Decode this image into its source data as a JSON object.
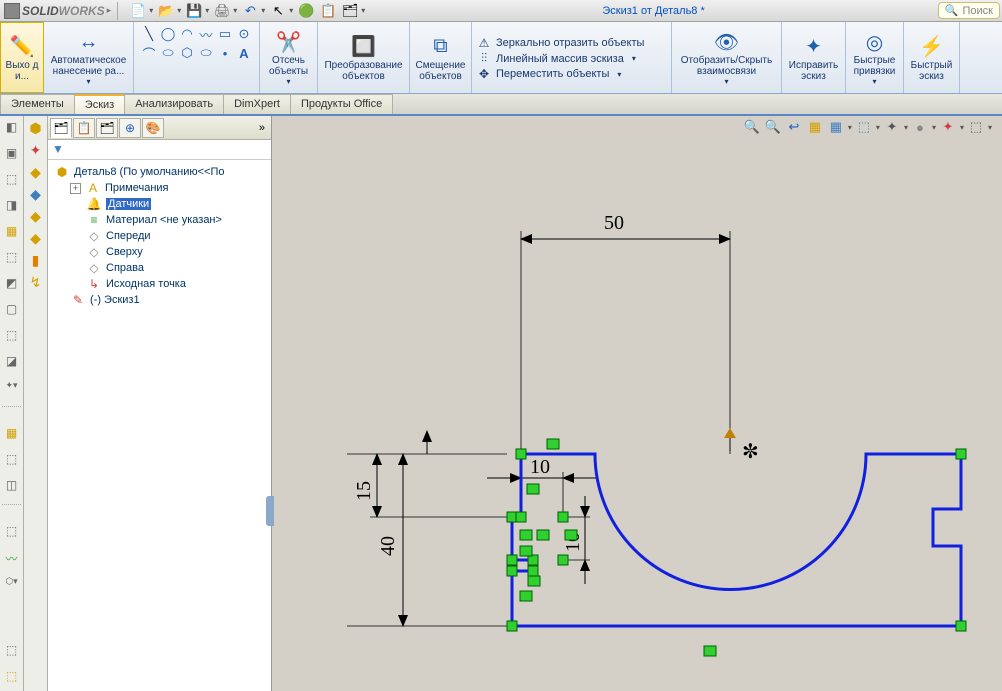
{
  "app": {
    "logo_a": "SOLID",
    "logo_b": "WORKS",
    "doc_title": "Эскиз1 от Деталь8 *",
    "search_placeholder": "Поиск"
  },
  "ribbon": {
    "exit_sketch": "Выхо д и...",
    "auto_dim": "Автоматическое нанесение ра...",
    "trim": "Отсечь объекты",
    "convert": "Преобразование объектов",
    "offset": "Смещение объектов",
    "mirror": "Зеркально отразить объекты",
    "linear_pattern": "Линейный массив эскиза",
    "move": "Переместить объекты",
    "display_relations": "Отобразить/Скрыть взаимосвязи",
    "repair": "Исправить эскиз",
    "quick_snaps": "Быстрые привязки",
    "rapid_sketch": "Быстрый эскиз"
  },
  "tabs": {
    "features": "Элементы",
    "sketch": "Эскиз",
    "evaluate": "Анализировать",
    "dimxpert": "DimXpert",
    "office": "Продукты Office"
  },
  "tree": {
    "root": "Деталь8  (По умолчанию<<По",
    "annotations": "Примечания",
    "sensors": "Датчики",
    "material": "Материал <не указан>",
    "front": "Спереди",
    "top": "Сверху",
    "right": "Справа",
    "origin": "Исходная точка",
    "sketch1": "(-) Эскиз1"
  },
  "dims": {
    "d50": "50",
    "d40": "40",
    "d15": "15",
    "d10a": "10",
    "d10b": "10"
  }
}
